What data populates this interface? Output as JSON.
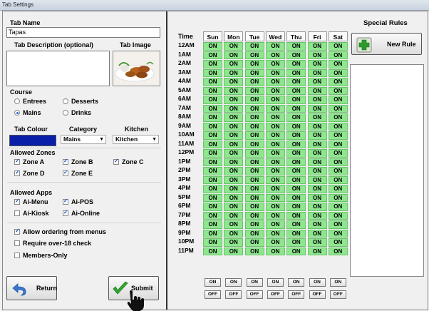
{
  "window": {
    "title": "Tab Settings"
  },
  "tab_name": {
    "label": "Tab Name",
    "value": "Tapas"
  },
  "tab_description": {
    "label": "Tab Description (optional)",
    "value": ""
  },
  "tab_image": {
    "label": "Tab Image"
  },
  "course": {
    "label": "Course",
    "options": [
      "Entrees",
      "Desserts",
      "Mains",
      "Drinks"
    ],
    "selected": "Mains"
  },
  "tab_colour": {
    "label": "Tab Colour",
    "color": "#0a1fa8"
  },
  "category": {
    "label": "Category",
    "value": "Mains"
  },
  "kitchen": {
    "label": "Kitchen",
    "value": "Kitchen"
  },
  "allowed_zones": {
    "label": "Allowed Zones",
    "items": [
      {
        "label": "Zone A",
        "checked": true
      },
      {
        "label": "Zone B",
        "checked": true
      },
      {
        "label": "Zone C",
        "checked": true
      },
      {
        "label": "Zone D",
        "checked": true
      },
      {
        "label": "Zone E",
        "checked": true
      }
    ]
  },
  "allowed_apps": {
    "label": "Allowed Apps",
    "items": [
      {
        "label": "Ai-Menu",
        "checked": true
      },
      {
        "label": "Ai-POS",
        "checked": true
      },
      {
        "label": "Ai-Kiosk",
        "checked": false
      },
      {
        "label": "Ai-Online",
        "checked": true
      }
    ]
  },
  "options": [
    {
      "label": "Allow ordering from menus",
      "checked": true
    },
    {
      "label": "Require over-18 check",
      "checked": false
    },
    {
      "label": "Members-Only",
      "checked": false
    }
  ],
  "buttons": {
    "return": "Return",
    "submit": "Submit",
    "new_rule": "New Rule"
  },
  "special_rules": {
    "label": "Special Rules"
  },
  "schedule": {
    "time_header": "Time",
    "days": [
      "Sun",
      "Mon",
      "Tue",
      "Wed",
      "Thu",
      "Fri",
      "Sat"
    ],
    "times": [
      "12AM",
      "1AM",
      "2AM",
      "3AM",
      "4AM",
      "5AM",
      "6AM",
      "7AM",
      "8AM",
      "9AM",
      "10AM",
      "11AM",
      "12PM",
      "1PM",
      "2PM",
      "3PM",
      "4PM",
      "5PM",
      "6PM",
      "7PM",
      "8PM",
      "9PM",
      "10PM",
      "11PM"
    ],
    "cell_value": "ON",
    "on_label": "ON",
    "off_label": "OFF"
  },
  "colors": {
    "on_cell": "#8ee68e",
    "submit_check": "#2fa82f",
    "return_arrow": "#3a78d0"
  }
}
